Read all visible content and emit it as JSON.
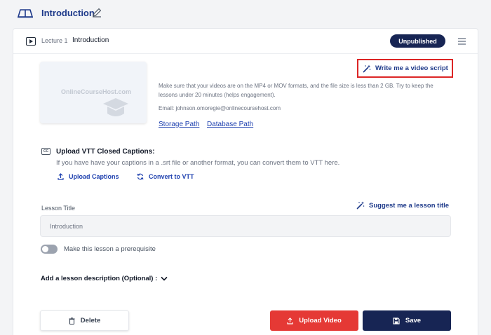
{
  "header": {
    "section_title": "Introduction",
    "section_icon": "book-open-icon",
    "edit_icon": "pencil-icon"
  },
  "lesson": {
    "lecture_number": "Lecture 1",
    "title": "Introduction",
    "status": "Unpublished",
    "thumbnail_logo": "OnlineCourseHost.com",
    "write_script_label": "Write me a video script",
    "info_text": "Make sure that your videos are on the MP4 or MOV formats, and the file size is less than 2 GB. Try to keep the lessons under 20 minutes (helps engagement).",
    "email_text": "Email: johnson.omoregie@onlinecoursehost.com",
    "storage_path_label": "Storage Path",
    "database_path_label": "Database Path"
  },
  "captions": {
    "title": "Upload VTT Closed Captions:",
    "description": "If you have have your captions in a .srt file or another format, you can convert them to VTT here.",
    "upload_label": "Upload Captions",
    "convert_label": "Convert to VTT"
  },
  "form": {
    "lesson_title_label": "Lesson Title",
    "suggest_label": "Suggest me a lesson title",
    "lesson_title_value": "Introduction",
    "prerequisite_label": "Make this lesson a prerequisite",
    "prerequisite_on": false,
    "description_toggle_label": "Add a lesson description (Optional) :"
  },
  "actions": {
    "delete_label": "Delete",
    "upload_video_label": "Upload Video",
    "save_label": "Save"
  },
  "colors": {
    "navy": "#172554",
    "link_blue": "#1e40af",
    "danger_red": "#e53935",
    "highlight_border": "#dc2626"
  }
}
